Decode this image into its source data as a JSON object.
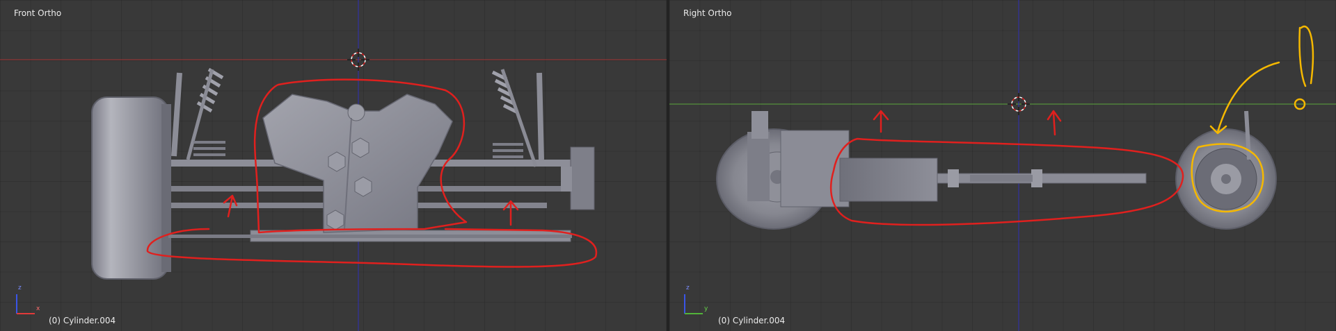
{
  "viewports": [
    {
      "title": "Front Ortho",
      "object_info": "(0) Cylinder.004",
      "gizmo": {
        "up": "z",
        "right": "x"
      }
    },
    {
      "title": "Right Ortho",
      "object_info": "(0) Cylinder.004",
      "gizmo": {
        "up": "z",
        "right": "y"
      }
    }
  ],
  "annotation_text": "!",
  "colors": {
    "background": "#393939",
    "horizon_x_axis": "#a33434",
    "horizon_y_axis": "#5aa83a",
    "vertical_axis": "#3030b8",
    "mesh": "#8a8b96",
    "annotation_red": "#e0201e",
    "annotation_yellow": "#f5b800"
  }
}
